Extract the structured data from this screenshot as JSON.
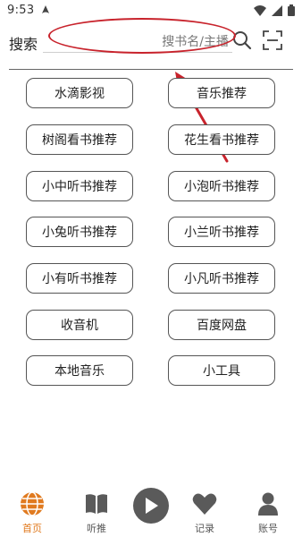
{
  "status_bar": {
    "time": "9:53"
  },
  "search": {
    "label": "搜索",
    "placeholder": "搜书名/主播"
  },
  "menu": {
    "items": [
      {
        "label": "水滴影视"
      },
      {
        "label": "音乐推荐"
      },
      {
        "label": "树阁看书推荐"
      },
      {
        "label": "花生看书推荐"
      },
      {
        "label": "小中听书推荐"
      },
      {
        "label": "小泡听书推荐"
      },
      {
        "label": "小兔听书推荐"
      },
      {
        "label": "小兰听书推荐"
      },
      {
        "label": "小有听书推荐"
      },
      {
        "label": "小凡听书推荐"
      },
      {
        "label": "收音机"
      },
      {
        "label": "百度网盘"
      },
      {
        "label": "本地音乐"
      },
      {
        "label": "小工具"
      }
    ]
  },
  "bottom_nav": {
    "items": [
      {
        "label": "首页",
        "icon": "globe-icon",
        "active": true
      },
      {
        "label": "听推",
        "icon": "book-icon",
        "active": false
      },
      {
        "label": "",
        "icon": "play-icon",
        "active": false
      },
      {
        "label": "记录",
        "icon": "heart-icon",
        "active": false
      },
      {
        "label": "账号",
        "icon": "person-icon",
        "active": false
      }
    ]
  },
  "colors": {
    "accent": "#e07a1f",
    "annotation": "#c8232c",
    "icon_gray": "#5a5a5a",
    "button_border": "#555555"
  }
}
